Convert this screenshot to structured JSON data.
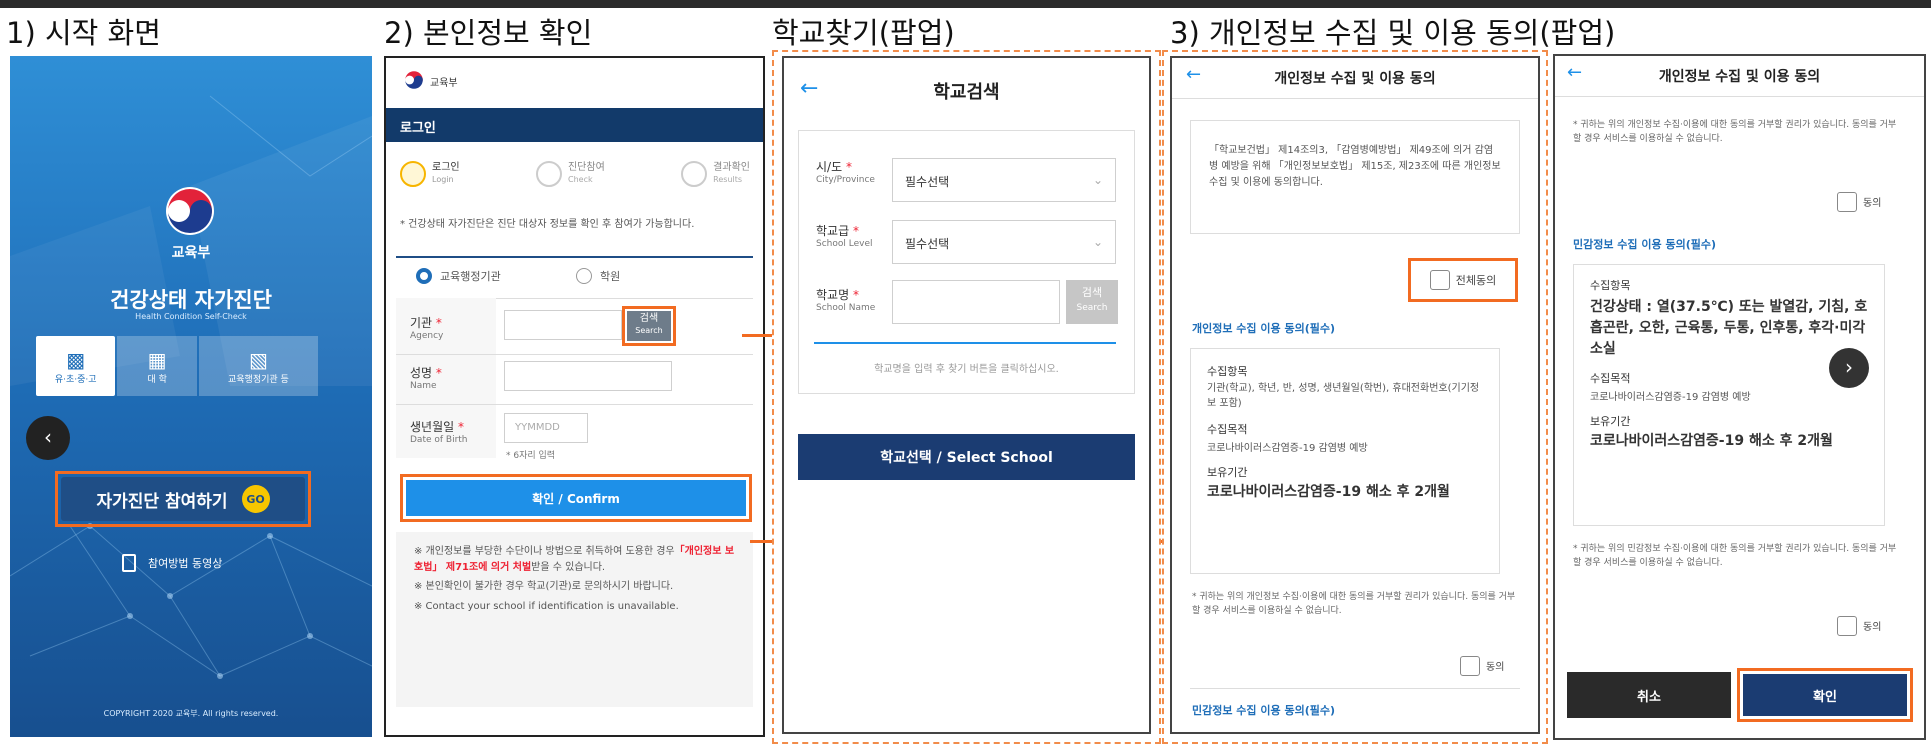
{
  "headings": {
    "h1": "1) 시작 화면",
    "h2": "2) 본인정보 확인",
    "h3": "학교찾기(팝업)",
    "h4": "3) 개인정보 수집 및 이용 동의(팝업)"
  },
  "screen1": {
    "ministry": "교육부",
    "title": "건강상태 자가진단",
    "subtitle": "Health Condition Self-Check",
    "tabs": [
      "유·초·중·고",
      "대 학",
      "교육행정기관 등"
    ],
    "join_button": "자가진단 참여하기",
    "go_badge": "GO",
    "video_link": "참여방법 동영상",
    "copyright": "COPYRIGHT 2020 교육부. All rights reserved."
  },
  "screen2": {
    "logo_text": "교육부",
    "section_title": "로그인",
    "steps": [
      {
        "ko": "로그인",
        "en": "Login"
      },
      {
        "ko": "진단참여",
        "en": "Check"
      },
      {
        "ko": "결과확인",
        "en": "Results"
      }
    ],
    "notice": "* 건강상태 자가진단은 진단 대상자 정보를 확인 후 참여가 가능합니다.",
    "radio1": "교육행정기관",
    "radio2": "학원",
    "agency_label": "기관",
    "agency_en": "Agency",
    "search_ko": "검색",
    "search_en": "Search",
    "name_label": "성명",
    "name_en": "Name",
    "dob_label": "생년월일",
    "dob_en": "Date of Birth",
    "dob_placeholder": "YYMMDD",
    "dob_hint": "* 6자리 입력",
    "confirm_button": "확인 / Confirm",
    "info1_a": "※ 개인정보를 부당한 수단이나 방법으로 취득하여 도용한 경우",
    "info1_red": "「개인정보 보호법」 제71조에 의거 처벌",
    "info1_b": "받을 수 있습니다.",
    "info2": "※ 본인확인이 불가한 경우 학교(기관)로 문의하시기 바랍니다.",
    "info3": "※ Contact your school if identification is unavailable."
  },
  "screen3": {
    "title": "학교검색",
    "city_label": "시/도",
    "city_en": "City/Province",
    "city_value": "필수선택",
    "level_label": "학교급",
    "level_en": "School Level",
    "level_value": "필수선택",
    "school_label": "학교명",
    "school_en": "School Name",
    "search_ko": "검색",
    "search_en": "Search",
    "hint": "학교명을 입력 후 찾기 버튼을 클릭하십시오.",
    "select_button": "학교선택 / Select School"
  },
  "screen4": {
    "title": "개인정보 수집 및 이용 동의",
    "intro": "「학교보건법」 제14조의3, 「감염병예방법」 제49조에 의거 감염병 예방을 위해 「개인정보보호법」 제15조, 제23조에 따른 개인정보 수집 및 이용에 동의합니다.",
    "agree_all": "전체동의",
    "sec1_title": "개인정보 수집 이용 동의(필수)",
    "items_label": "수집항목",
    "items_value": "기관(학교), 학년, 반, 성명, 생년월일(학번), 휴대전화번호(기기정보 포함)",
    "purpose_label": "수집목적",
    "purpose_value": "코로나바이러스감염증-19 감염병 예방",
    "period_label": "보유기간",
    "period_value": "코로나바이러스감염증-19 해소 후 2개월",
    "refuse_note": "* 귀하는 위의 개인정보 수집·이용에 대한 동의를 거부할 권리가 있습니다. 동의를 거부할 경우 서비스를 이용하실 수 없습니다.",
    "agree": "동의",
    "sec2_title": "민감정보 수집 이용 동의(필수)"
  },
  "screen5": {
    "title": "개인정보 수집 및 이용 동의",
    "refuse_note": "* 귀하는 위의 개인정보 수집·이용에 대한 동의를 거부할 권리가 있습니다. 동의를 거부할 경우 서비스를 이용하실 수 없습니다.",
    "agree": "동의",
    "sec_title": "민감정보 수집 이용 동의(필수)",
    "items_label": "수집항목",
    "items_value": "건강상태 : 열(37.5℃) 또는 발열감, 기침, 호흡곤란, 오한, 근육통, 두통, 인후통, 후각·미각 소실",
    "purpose_label": "수집목적",
    "purpose_value": "코로나바이러스감염증-19 감염병 예방",
    "period_label": "보유기간",
    "period_value": "코로나바이러스감염증-19 해소 후 2개월",
    "refuse_note2": "* 귀하는 위의 민감정보 수집·이용에 대한 동의를 거부할 권리가 있습니다. 동의를 거부할 경우 서비스를 이용하실 수 없습니다.",
    "cancel": "취소",
    "confirm": "확인"
  }
}
